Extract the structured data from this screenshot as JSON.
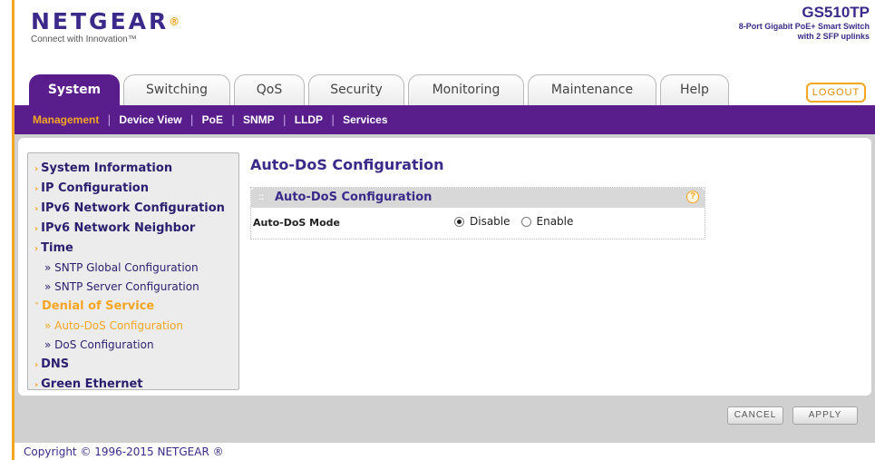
{
  "brand": {
    "logo_text": "NETGEAR",
    "logo_mark": "®",
    "tagline": "Connect with Innovation™"
  },
  "product": {
    "model": "GS510TP",
    "description_line1": "8-Port Gigabit PoE+ Smart Switch",
    "description_line2": "with 2 SFP uplinks"
  },
  "tabs": [
    {
      "label": "System",
      "active": true
    },
    {
      "label": "Switching"
    },
    {
      "label": "QoS"
    },
    {
      "label": "Security"
    },
    {
      "label": "Monitoring"
    },
    {
      "label": "Maintenance"
    },
    {
      "label": "Help"
    }
  ],
  "logout_label": "LOGOUT",
  "subnav": [
    {
      "label": "Management",
      "active": true
    },
    {
      "label": "Device View"
    },
    {
      "label": "PoE"
    },
    {
      "label": "SNMP"
    },
    {
      "label": "LLDP"
    },
    {
      "label": "Services"
    }
  ],
  "sidebar": {
    "items": [
      {
        "label": "System Information"
      },
      {
        "label": "IP Configuration"
      },
      {
        "label": "IPv6 Network Configuration"
      },
      {
        "label": "IPv6 Network Neighbor"
      },
      {
        "label": "Time"
      },
      {
        "label": "» SNTP Global Configuration"
      },
      {
        "label": "» SNTP Server Configuration"
      },
      {
        "label": "Denial of Service"
      },
      {
        "label": "» Auto-DoS Configuration"
      },
      {
        "label": "» DoS Configuration"
      },
      {
        "label": "DNS"
      },
      {
        "label": "Green Ethernet"
      }
    ]
  },
  "main": {
    "page_title": "Auto-DoS Configuration",
    "panel_title": "Auto-DoS Configuration",
    "help_glyph": "?",
    "field_label": "Auto-DoS Mode",
    "options": [
      {
        "label": "Disable",
        "selected": true
      },
      {
        "label": "Enable",
        "selected": false
      }
    ]
  },
  "buttons": {
    "cancel": "CANCEL",
    "apply": "APPLY"
  },
  "footer": {
    "copyright": "Copyright © 1996-2015 NETGEAR ®"
  },
  "colors": {
    "brand_purple": "#5a1e8c",
    "accent_orange": "#f5a623",
    "text_navy": "#3b2a8a"
  }
}
